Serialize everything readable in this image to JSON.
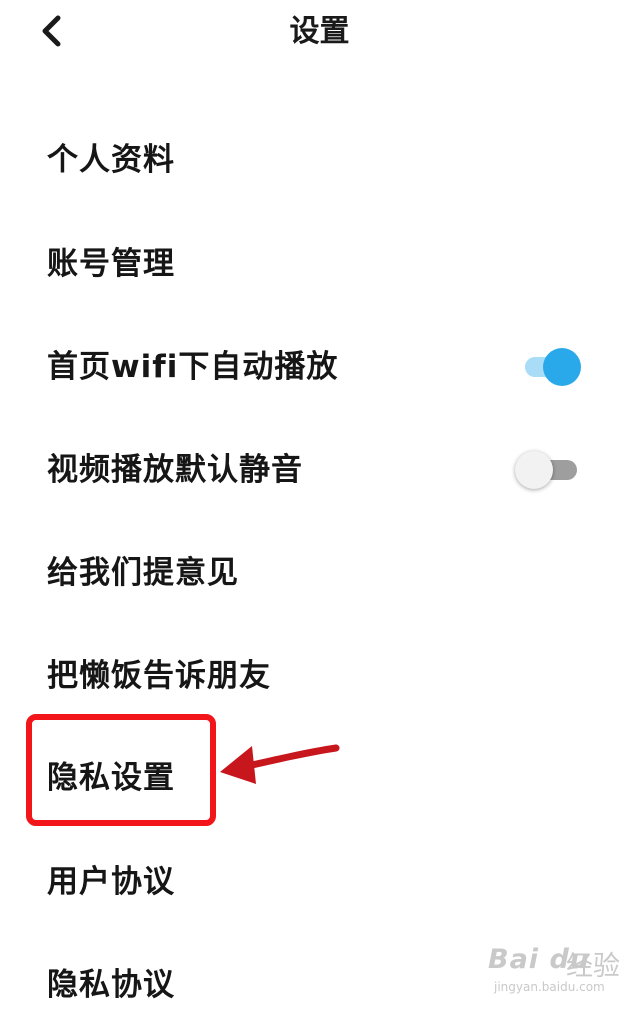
{
  "header": {
    "title": "设置",
    "back_icon": "chevron-left-icon"
  },
  "settings": [
    {
      "label": "个人资料"
    },
    {
      "label": "账号管理"
    },
    {
      "label": "首页wifi下自动播放",
      "toggle": true
    },
    {
      "label": "视频播放默认静音",
      "toggle": false
    },
    {
      "label": "给我们提意见"
    },
    {
      "label": "把懒饭告诉朋友"
    },
    {
      "label": "隐私设置"
    },
    {
      "label": "用户协议"
    },
    {
      "label": "隐私协议"
    }
  ],
  "annotation": {
    "highlight_color": "#f2161b",
    "arrow_color": "#c8161d"
  },
  "colors": {
    "toggle_on_knob": "#2aa9ea",
    "toggle_on_track": "#a9dcf7",
    "toggle_off_track": "#9e9e9e"
  },
  "watermark": {
    "logo": "Bai du",
    "sub": "经验",
    "url": "jingyan.baidu.com"
  }
}
